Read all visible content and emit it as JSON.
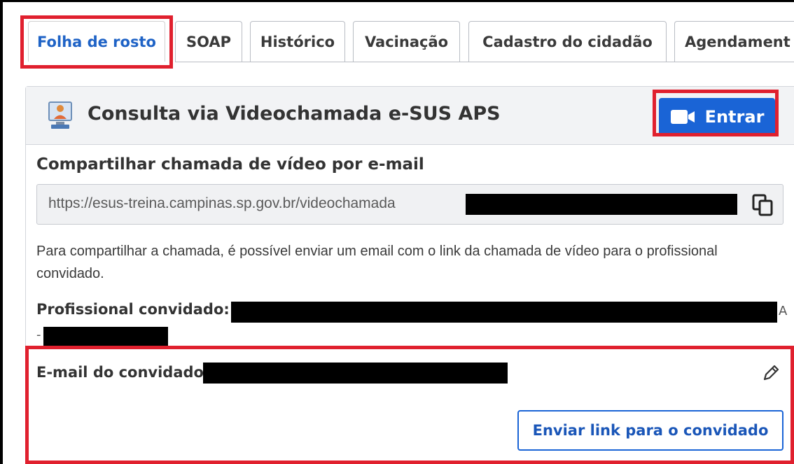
{
  "tabs": [
    {
      "label": "Folha de rosto",
      "active": true
    },
    {
      "label": "SOAP"
    },
    {
      "label": "Histórico"
    },
    {
      "label": "Vacinação"
    },
    {
      "label": "Cadastro do cidadão"
    },
    {
      "label": "Agendament"
    }
  ],
  "card": {
    "title": "Consulta via Videochamada e-SUS APS",
    "enter_label": "Entrar",
    "share_title": "Compartilhar chamada de vídeo por e-mail",
    "url_value": "https://esus-treina.campinas.sp.gov.br/videochamada",
    "description": "Para compartilhar a chamada, é possível enviar um email com o link da chamada de vídeo para o profissional convidado.",
    "professional_label": "Profissional convidado:",
    "professional_trail_char": "A",
    "professional_lead_char": "-",
    "email_label": "E-mail do convidado:",
    "send_button_label": "Enviar link para o convidado"
  },
  "colors": {
    "accent": "#1a64d6",
    "highlight": "#e0202e",
    "redaction": "#000000"
  },
  "icons": {
    "header": "video-consultation-icon",
    "enter": "video-camera-icon",
    "copy": "copy-icon",
    "edit": "pencil-icon"
  }
}
